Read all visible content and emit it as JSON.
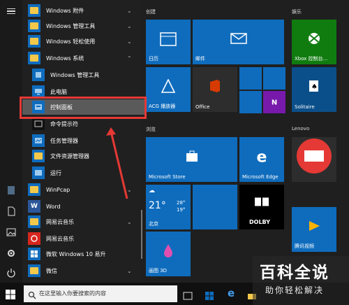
{
  "apps": {
    "rows": [
      {
        "label": "Windows 附件",
        "kind": "folder"
      },
      {
        "label": "Windows 管理工具",
        "kind": "folder"
      },
      {
        "label": "Windows 轻松使用",
        "kind": "folder"
      },
      {
        "label": "Windows 系统",
        "kind": "folder-open"
      },
      {
        "label": "Windows 管理工具",
        "kind": "sub"
      },
      {
        "label": "此电脑",
        "kind": "sub"
      },
      {
        "label": "控制面板",
        "kind": "sub"
      },
      {
        "label": "命令提示符",
        "kind": "sub"
      },
      {
        "label": "任务管理器",
        "kind": "sub"
      },
      {
        "label": "文件资源管理器",
        "kind": "sub"
      },
      {
        "label": "运行",
        "kind": "sub"
      },
      {
        "label": "WinPcap",
        "kind": "folder"
      },
      {
        "label": "Word",
        "kind": "app"
      },
      {
        "label": "网易云音乐",
        "kind": "folder"
      },
      {
        "label": "网易云音乐",
        "kind": "app"
      },
      {
        "label": "微软 Windows 10 易升",
        "kind": "app"
      },
      {
        "label": "微信",
        "kind": "folder"
      }
    ]
  },
  "sections": {
    "create": "创建",
    "browse": "浏览",
    "entertainment": "娱乐",
    "lenovo": "Lenovo"
  },
  "tiles": {
    "calendar": "日历",
    "mail": "邮件",
    "acg": "ACG 播放器",
    "office": "Office",
    "store": "Microsoft Store",
    "edge": "Microsoft Edge",
    "weather_temp": "21°",
    "weather_high": "28°",
    "weather_low": "19°",
    "weather_city": "北京",
    "paint3d": "画图 3D",
    "xbox": "Xbox 控制台...",
    "solitaire": "Solitaire",
    "tencent_video": "腾讯视频",
    "dolby": "DOLBY"
  },
  "search": {
    "placeholder": "在这里输入你要搜索的内容"
  },
  "watermark": {
    "line1": "百科全说",
    "line2": "助你轻松解决"
  },
  "colors": {
    "tile_blue": "#0f6cbd",
    "annotation_red": "#e53935"
  }
}
